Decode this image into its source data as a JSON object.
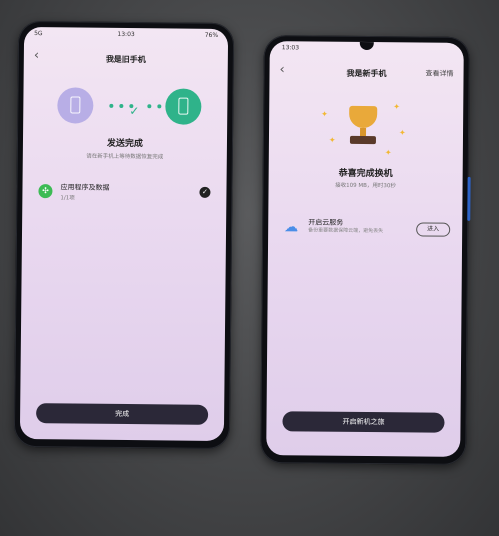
{
  "left_phone": {
    "status": {
      "carrier": "5G",
      "time": "13:03",
      "battery": "76%"
    },
    "title": "我是旧手机",
    "heading": "发送完成",
    "subtitle": "请在新手机上等待数据恢复完成",
    "item": {
      "label": "应用程序及数据",
      "count": "1/1项"
    },
    "done_button": "完成"
  },
  "right_phone": {
    "status": {
      "time": "13:03"
    },
    "title": "我是新手机",
    "details_link": "查看详情",
    "heading": "恭喜完成换机",
    "stats": "接收109 MB，用时30秒",
    "cloud": {
      "title": "开启云服务",
      "description": "备份重要数据保障云端，避免丢失",
      "enter_button": "进入"
    },
    "start_button": "开启新机之旅"
  },
  "colors": {
    "accent_green": "#2fb38a",
    "trophy_gold": "#e9a93a",
    "button_dark": "#2b2838"
  }
}
